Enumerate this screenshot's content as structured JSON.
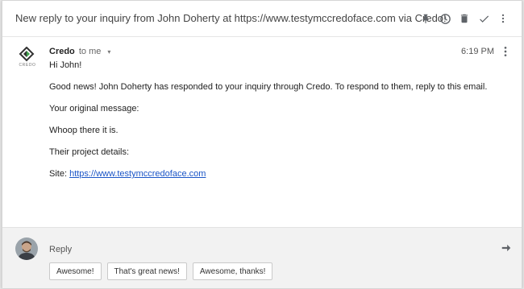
{
  "header": {
    "subject": "New reply to your inquiry from John Doherty at https://www.testymccredoface.com via Credo!",
    "icons": [
      "pin-icon",
      "clock-icon",
      "trash-icon",
      "check-icon",
      "more-vert-icon"
    ]
  },
  "message": {
    "logo_text": "CREDO",
    "sender": "Credo",
    "to": "to me",
    "time": "6:19 PM",
    "greeting": "Hi John!",
    "paragraph1": "Good news! John Doherty has responded to your inquiry through Credo. To respond to them, reply to this email.",
    "original_label": "Your original message:",
    "original_text": "Whoop there it is.",
    "details_label": "Their project details:",
    "site_label": "Site:",
    "site_url": "https://www.testymccredoface.com"
  },
  "reply": {
    "label": "Reply",
    "suggestions": [
      "Awesome!",
      "That's great news!",
      "Awesome, thanks!"
    ]
  },
  "colors": {
    "link": "#1a55c7",
    "logo_green": "#3fa34d",
    "reply_bg": "#f2f2f2"
  }
}
